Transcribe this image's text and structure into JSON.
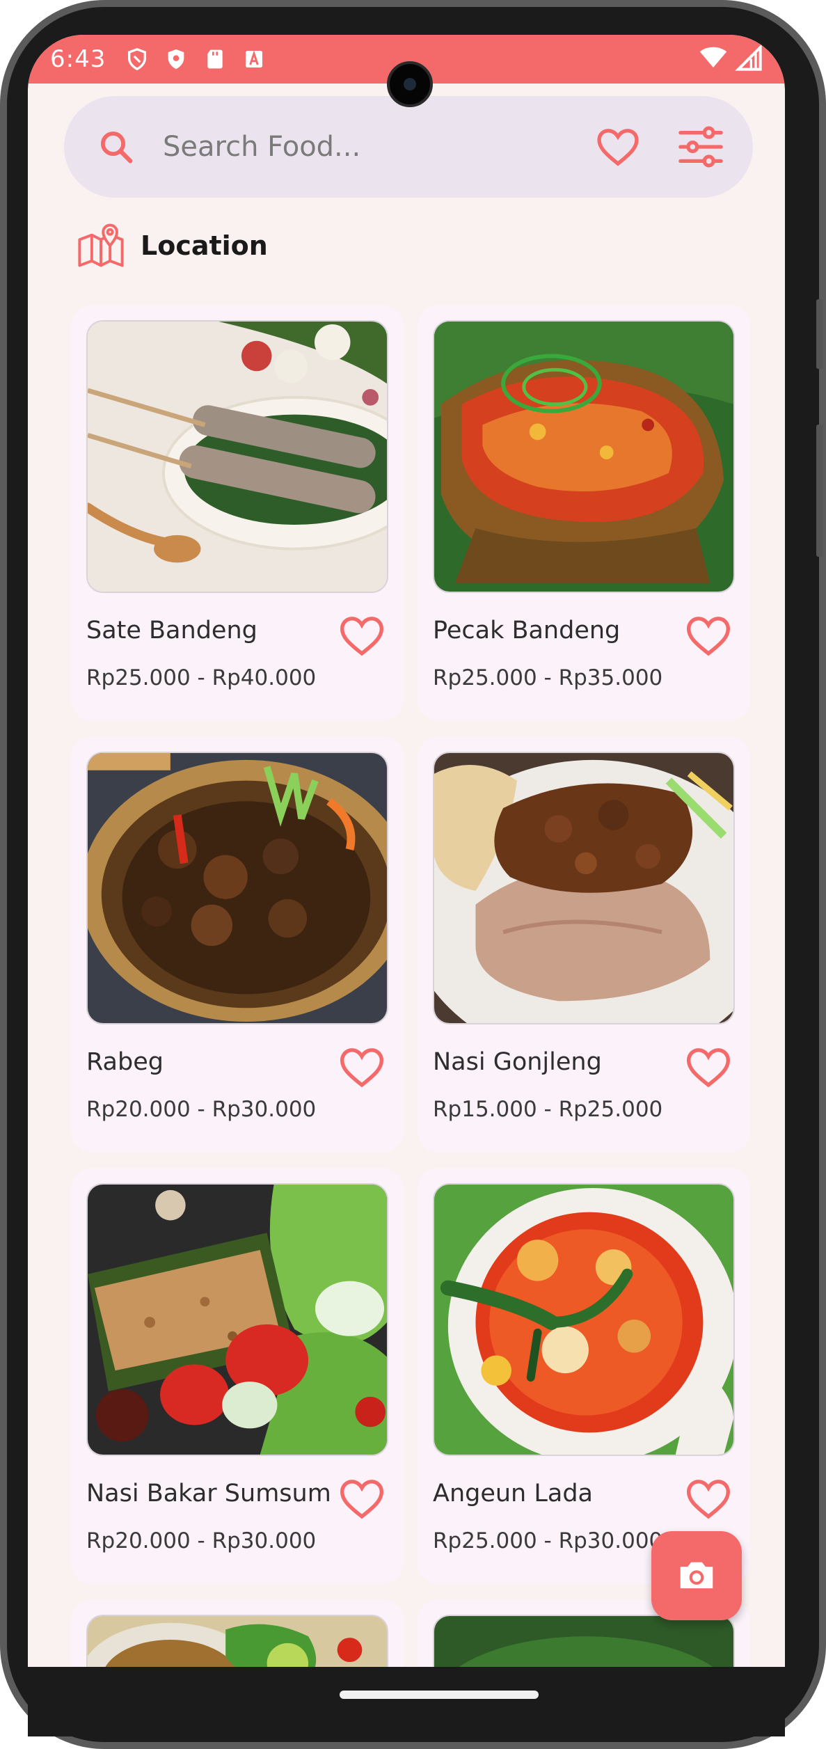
{
  "status_bar": {
    "time": "6:43",
    "icons": [
      "shield-outline-icon",
      "shield-filled-icon",
      "sd-card-icon",
      "font-a-icon"
    ],
    "right_icons": [
      "wifi-icon",
      "signal-icon"
    ]
  },
  "search": {
    "placeholder": "Search Food..."
  },
  "location": {
    "label": "Location"
  },
  "foods": [
    {
      "name": "Sate Bandeng",
      "price": "Rp25.000 - Rp40.000"
    },
    {
      "name": "Pecak Bandeng",
      "price": "Rp25.000 - Rp35.000"
    },
    {
      "name": "Rabeg",
      "price": "Rp20.000 - Rp30.000"
    },
    {
      "name": "Nasi Gonjleng",
      "price": "Rp15.000 - Rp25.000"
    },
    {
      "name": "Nasi Bakar Sumsum",
      "price": "Rp20.000 - Rp30.000"
    },
    {
      "name": "Angeun Lada",
      "price": "Rp25.000 - Rp30.000"
    }
  ],
  "colors": {
    "accent": "#f46a6a",
    "background": "#faf2f0",
    "card": "#fbf2fa",
    "search_bg": "#ebe4ee"
  }
}
